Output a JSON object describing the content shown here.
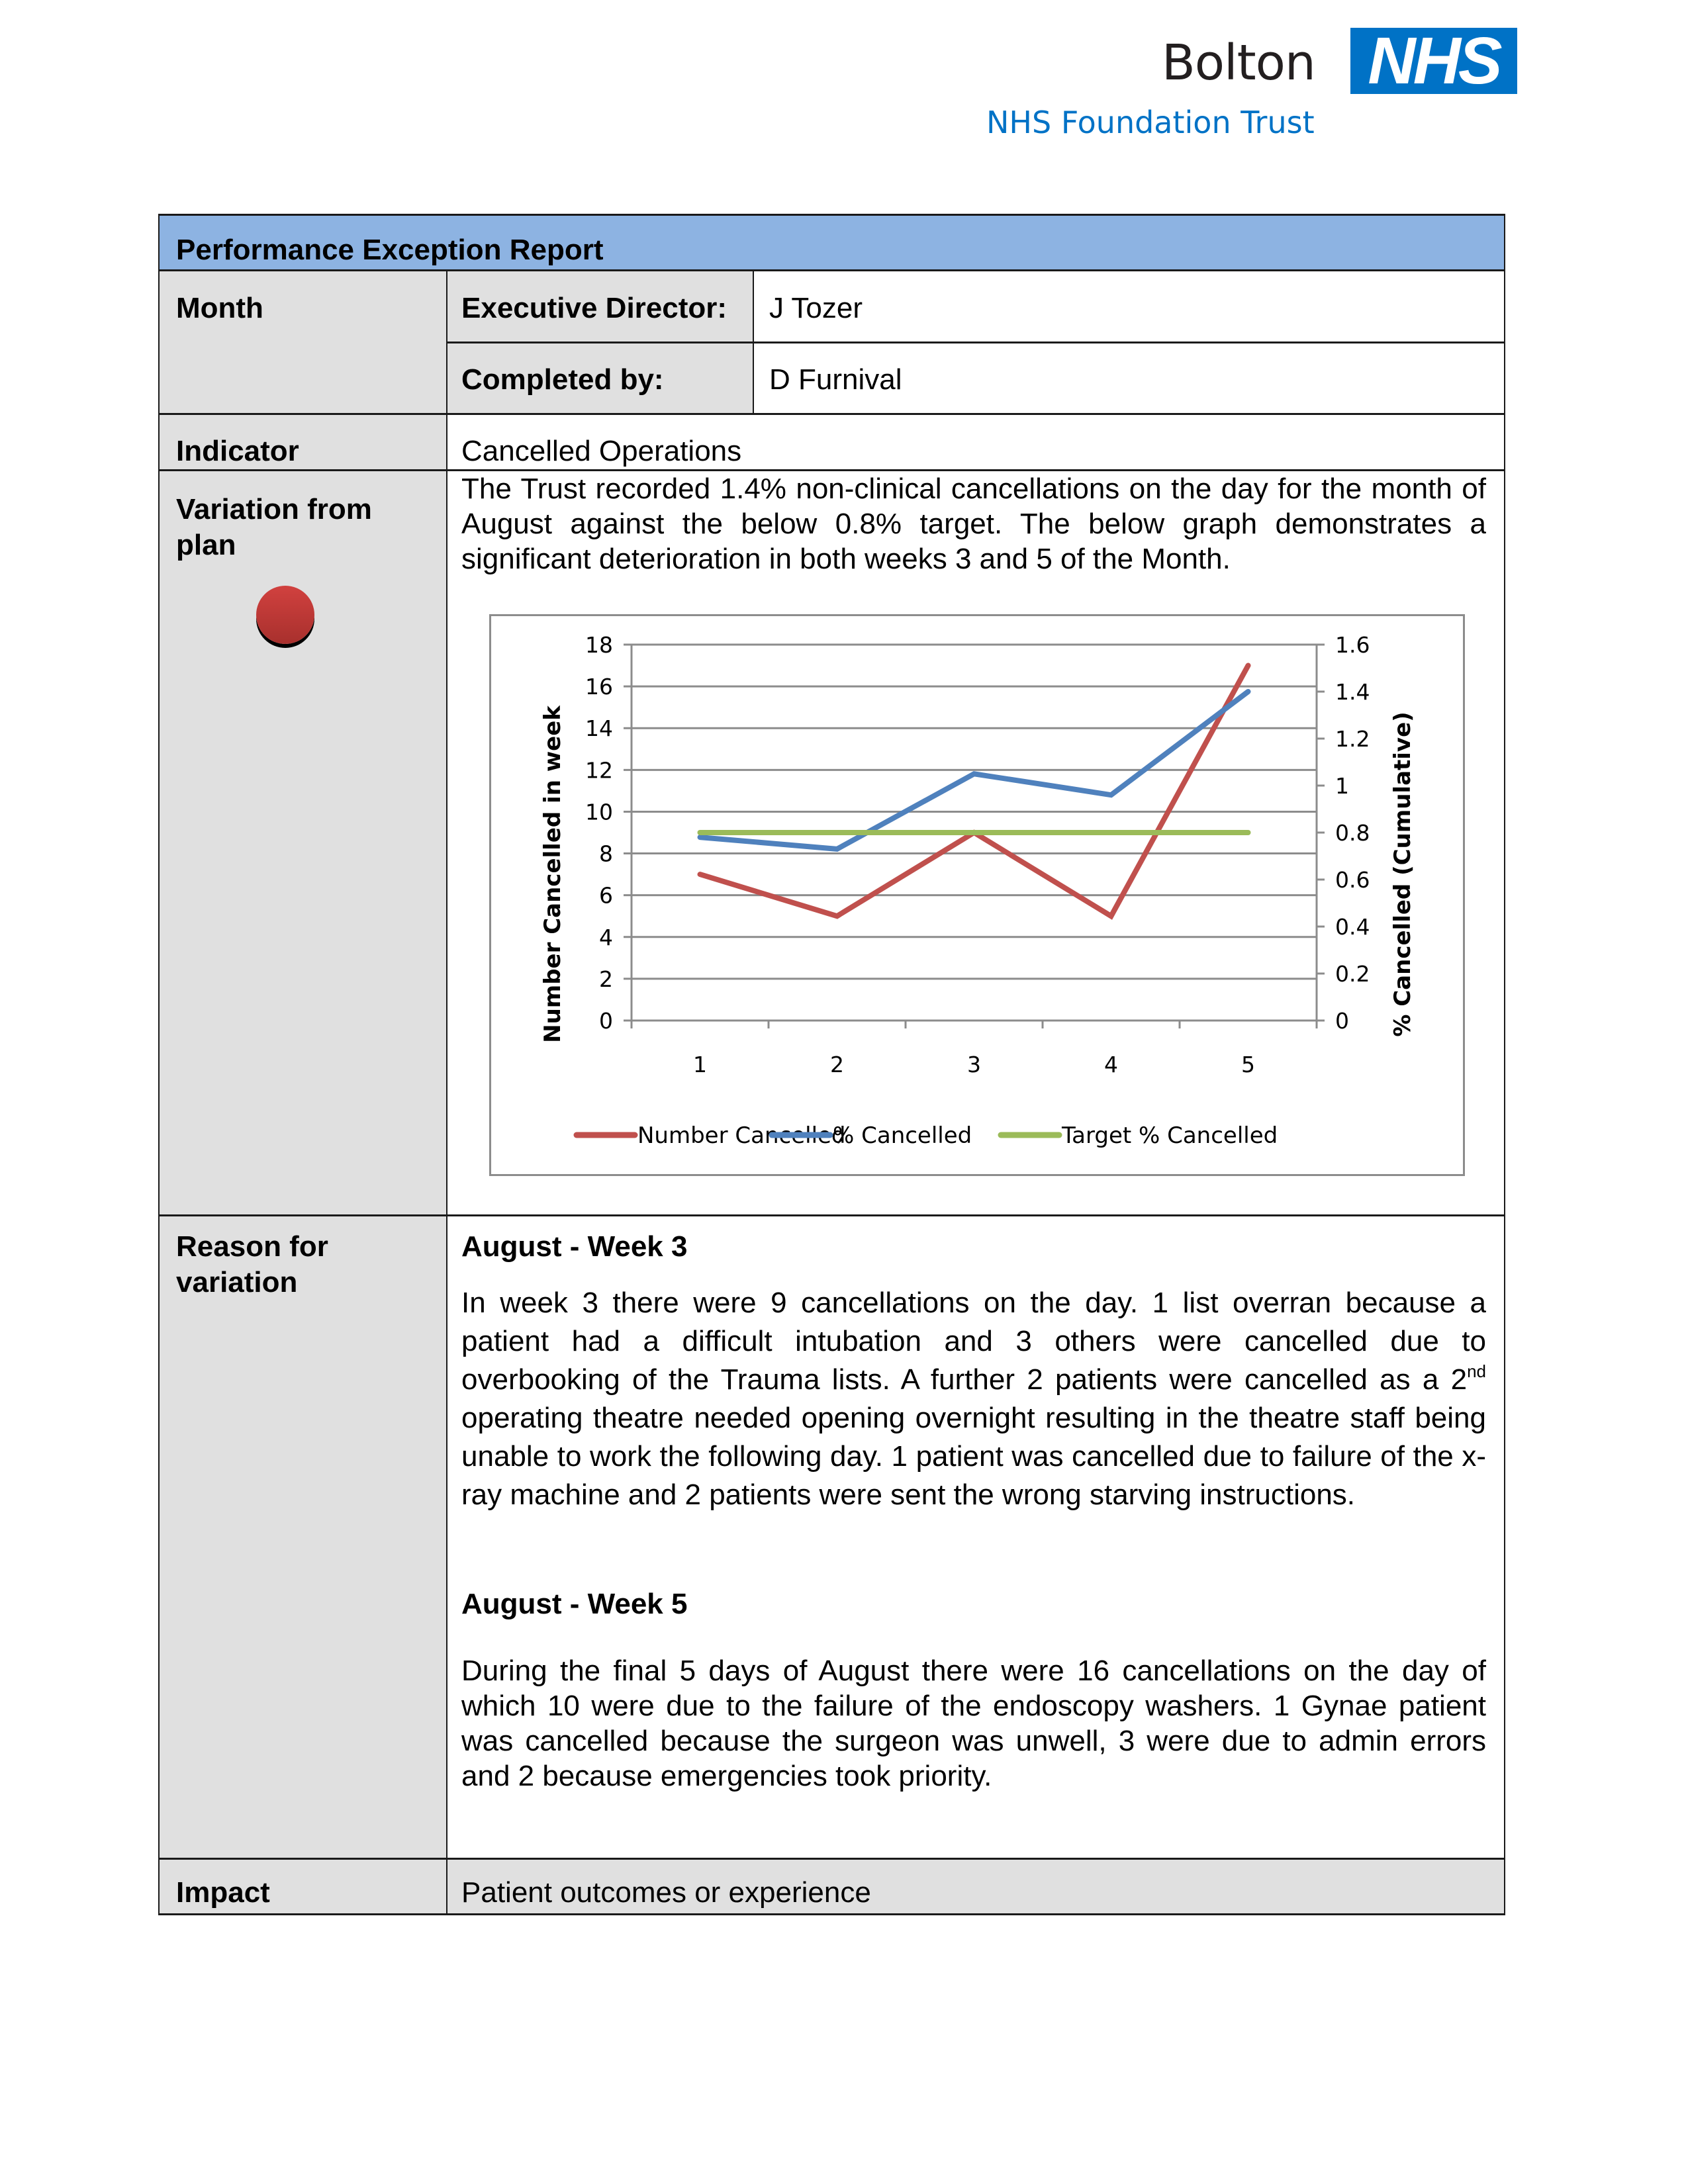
{
  "logo": {
    "org_name": "Bolton",
    "badge": "NHS",
    "subtitle": "NHS Foundation Trust",
    "brand_color": "#0072C6"
  },
  "report": {
    "title": "Performance Exception Report",
    "month_label": "Month",
    "month_value": "",
    "executive_director_label": "Executive Director:",
    "executive_director_value": "J Tozer",
    "completed_by_label": "Completed by:",
    "completed_by_value": "D Furnival",
    "indicator_label": "Indicator",
    "indicator_value": "Cancelled Operations",
    "variation_label_line1": "Variation from",
    "variation_label_line2": "plan",
    "variation_status": "red",
    "variation_text": "The Trust recorded 1.4% non-clinical cancellations on the day for the month of August against the below 0.8% target.  The below graph demonstrates a significant deterioration in both weeks 3 and 5 of the Month.",
    "reason_label_line1": "Reason for",
    "reason_label_line2": "variation",
    "week3_heading": "August - Week 3",
    "week3_text_before_sup": "In week 3 there were 9 cancellations on the day. 1 list overran because a patient had a difficult intubation and 3 others were cancelled due to overbooking of the Trauma lists. A further 2 patients were cancelled as a 2",
    "week3_sup": "nd",
    "week3_text_after_sup": " operating theatre needed opening overnight resulting in the theatre staff being unable to work the following day. 1 patient was cancelled due to failure of the x-ray machine and 2 patients were sent the wrong starving instructions.",
    "week5_heading": "August - Week 5",
    "week5_text": "During the final 5 days of August there were 16 cancellations on the day of which 10 were due to the failure of the endoscopy washers.  1 Gynae patient was cancelled because the surgeon was unwell, 3 were due to admin errors and 2 because emergencies took priority.",
    "impact_label": "Impact",
    "impact_value": "Patient outcomes or experience"
  },
  "chart_data": {
    "type": "line",
    "title": "",
    "categories": [
      "1",
      "2",
      "3",
      "4",
      "5"
    ],
    "xlabel": "",
    "ylabel": "Number Cancelled in week",
    "y2label": "% Cancelled (Cumulative)",
    "ylim": [
      0,
      18
    ],
    "y_ticks": [
      "0",
      "2",
      "4",
      "6",
      "8",
      "10",
      "12",
      "14",
      "16",
      "18"
    ],
    "y2lim": [
      0,
      1.6
    ],
    "y2_ticks": [
      "0",
      "0.2",
      "0.4",
      "0.6",
      "0.8",
      "1",
      "1.2",
      "1.4",
      "1.6"
    ],
    "grid": true,
    "legend_position": "bottom",
    "series": [
      {
        "name": "Number Cancelled",
        "axis": "left",
        "color": "#C0504D",
        "values": [
          7,
          5,
          9,
          5,
          17
        ]
      },
      {
        "name": "% Cancelled",
        "axis": "right",
        "color": "#4F81BD",
        "values": [
          0.78,
          0.73,
          1.05,
          0.96,
          1.4
        ]
      },
      {
        "name": "Target % Cancelled",
        "axis": "right",
        "color": "#9BBB59",
        "values": [
          0.8,
          0.8,
          0.8,
          0.8,
          0.8
        ]
      }
    ]
  }
}
